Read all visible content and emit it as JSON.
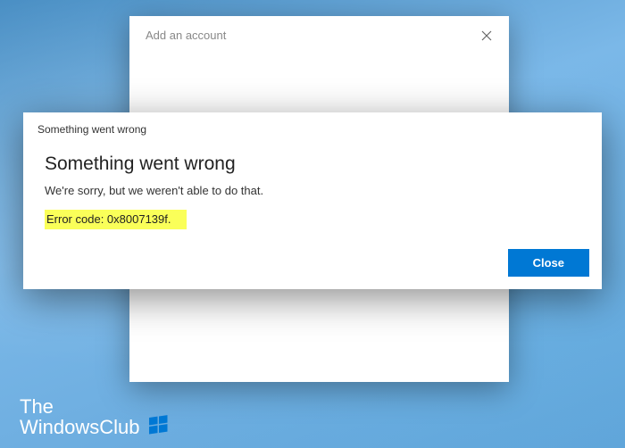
{
  "backDialog": {
    "title": "Add an account"
  },
  "frontDialog": {
    "titlebar": "Something went wrong",
    "heading": "Something went wrong",
    "subtext": "We're sorry, but we weren't able to do that.",
    "errorCode": "Error code: 0x8007139f.",
    "closeButton": "Close"
  },
  "watermark": {
    "line1": "The",
    "line2": "WindowsClub"
  },
  "colors": {
    "accent": "#0078d4",
    "highlight": "#faff59"
  }
}
